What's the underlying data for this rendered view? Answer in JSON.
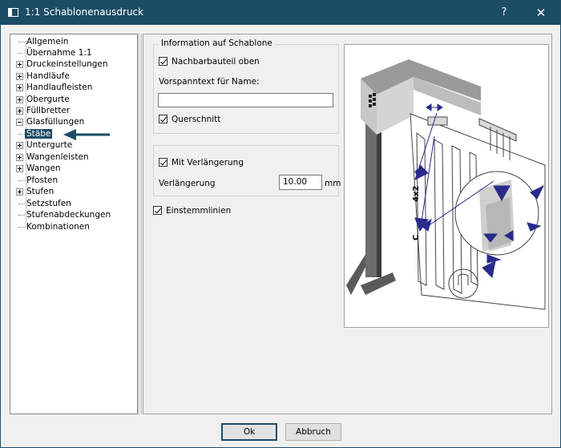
{
  "window": {
    "title": "1:1 Schablonenausdruck",
    "help_label": "?",
    "close_label": "✕"
  },
  "tree": {
    "items": [
      {
        "label": "Allgemein",
        "expandable": false
      },
      {
        "label": "Übernahme 1:1",
        "expandable": false
      },
      {
        "label": "Druckeinstellungen",
        "expandable": true
      },
      {
        "label": "Handläufe",
        "expandable": true
      },
      {
        "label": "Handlaufleisten",
        "expandable": true
      },
      {
        "label": "Obergurte",
        "expandable": true
      },
      {
        "label": "Füllbretter",
        "expandable": true
      },
      {
        "label": "Glasfüllungen",
        "expandable": true
      },
      {
        "label": "Stäbe",
        "expandable": false,
        "selected": true
      },
      {
        "label": "Untergurte",
        "expandable": true
      },
      {
        "label": "Wangenleisten",
        "expandable": true
      },
      {
        "label": "Wangen",
        "expandable": true
      },
      {
        "label": "Pfosten",
        "expandable": false
      },
      {
        "label": "Stufen",
        "expandable": true
      },
      {
        "label": "Setzstufen",
        "expandable": false
      },
      {
        "label": "Stufenabdeckungen",
        "expandable": false
      },
      {
        "label": "Kombinationen",
        "expandable": false
      }
    ]
  },
  "info_group": {
    "title": "Information auf Schablone",
    "neighbor_label": "Nachbarbauteil oben",
    "neighbor_checked": true,
    "prefix_label": "Vorspanntext für Name:",
    "prefix_value": "",
    "section_label": "Querschnitt",
    "section_checked": true
  },
  "extension_group": {
    "checkbox_label": "Mit Verlängerung",
    "checked": true,
    "length_label": "Verlängerung",
    "length_value": "10.00",
    "unit": "mm"
  },
  "einstemm": {
    "label": "Einstemmlinien",
    "checked": true
  },
  "preview": {
    "dimension_text": "4x2",
    "code_text": "C",
    "accent_color": "#2a2a8a",
    "annotation_arrow_color": "#1c4d66"
  },
  "buttons": {
    "ok": "Ok",
    "cancel": "Abbruch"
  }
}
